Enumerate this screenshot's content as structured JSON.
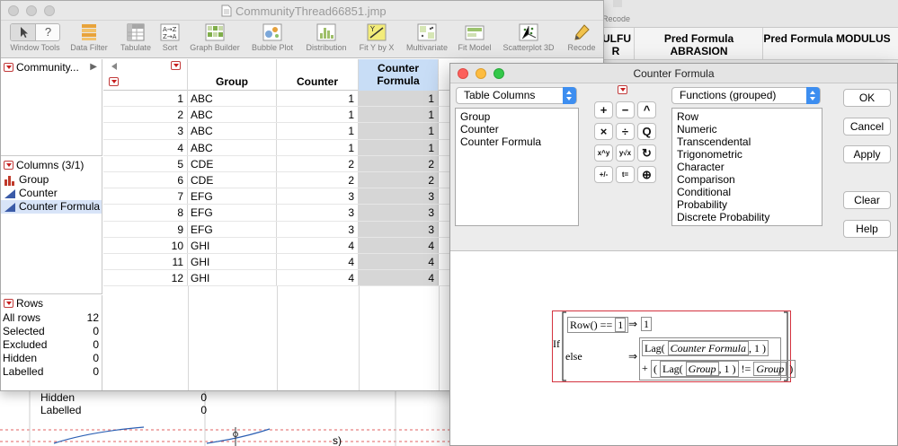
{
  "background_window": {
    "toolbar_partial_label": "Recode",
    "columns": [
      "ULFU R",
      "Pred Formula ABRASION",
      "Pred Formula MODULUS"
    ],
    "bottom_rows": [
      {
        "label": "Hidden",
        "value": "0"
      },
      {
        "label": "Labelled",
        "value": "0"
      }
    ],
    "bottom_text": "s)"
  },
  "data_table": {
    "title": "CommunityThread66851.jmp",
    "toolbar": [
      {
        "label": "Window Tools",
        "icon": "window-tools-icon"
      },
      {
        "label": "Data Filter",
        "icon": "data-filter-icon"
      },
      {
        "label": "Tabulate",
        "icon": "tabulate-icon"
      },
      {
        "label": "Sort",
        "icon": "sort-icon"
      },
      {
        "label": "Graph Builder",
        "icon": "graph-builder-icon"
      },
      {
        "label": "Bubble Plot",
        "icon": "bubble-plot-icon"
      },
      {
        "label": "Distribution",
        "icon": "distribution-icon"
      },
      {
        "label": "Fit Y by X",
        "icon": "fit-y-by-x-icon"
      },
      {
        "label": "Multivariate",
        "icon": "multivariate-icon"
      },
      {
        "label": "Fit Model",
        "icon": "fit-model-icon"
      },
      {
        "label": "Scatterplot 3D",
        "icon": "scatterplot-3d-icon"
      },
      {
        "label": "Recode",
        "icon": "recode-icon"
      }
    ],
    "table_panel": {
      "name": "Community..."
    },
    "columns_panel": {
      "header": "Columns (3/1)",
      "items": [
        {
          "name": "Group",
          "icon": "nominal-bar-icon"
        },
        {
          "name": "Counter",
          "icon": "continuous-triangle-icon"
        },
        {
          "name": "Counter Formula",
          "icon": "continuous-triangle-icon"
        }
      ]
    },
    "rows_panel": {
      "header": "Rows",
      "stats": [
        {
          "label": "All rows",
          "value": "12"
        },
        {
          "label": "Selected",
          "value": "0"
        },
        {
          "label": "Excluded",
          "value": "0"
        },
        {
          "label": "Hidden",
          "value": "0"
        },
        {
          "label": "Labelled",
          "value": "0"
        }
      ]
    },
    "grid": {
      "headers": {
        "group": "Group",
        "counter": "Counter",
        "counter_formula": "Counter Formula"
      },
      "rows": [
        {
          "n": "1",
          "group": "ABC",
          "counter": "1",
          "cf": "1"
        },
        {
          "n": "2",
          "group": "ABC",
          "counter": "1",
          "cf": "1"
        },
        {
          "n": "3",
          "group": "ABC",
          "counter": "1",
          "cf": "1"
        },
        {
          "n": "4",
          "group": "ABC",
          "counter": "1",
          "cf": "1"
        },
        {
          "n": "5",
          "group": "CDE",
          "counter": "2",
          "cf": "2"
        },
        {
          "n": "6",
          "group": "CDE",
          "counter": "2",
          "cf": "2"
        },
        {
          "n": "7",
          "group": "EFG",
          "counter": "3",
          "cf": "3"
        },
        {
          "n": "8",
          "group": "EFG",
          "counter": "3",
          "cf": "3"
        },
        {
          "n": "9",
          "group": "EFG",
          "counter": "3",
          "cf": "3"
        },
        {
          "n": "10",
          "group": "GHI",
          "counter": "4",
          "cf": "4"
        },
        {
          "n": "11",
          "group": "GHI",
          "counter": "4",
          "cf": "4"
        },
        {
          "n": "12",
          "group": "GHI",
          "counter": "4",
          "cf": "4"
        }
      ]
    }
  },
  "formula_dialog": {
    "title": "Counter Formula",
    "table_columns_popup": "Table Columns",
    "table_columns_list": [
      "Group",
      "Counter",
      "Counter Formula"
    ],
    "functions_popup": "Functions (grouped)",
    "functions_list": [
      "Row",
      "Numeric",
      "Transcendental",
      "Trigonometric",
      "Character",
      "Comparison",
      "Conditional",
      "Probability",
      "Discrete Probability"
    ],
    "keypad": [
      "+",
      "−",
      "^",
      "×",
      "÷",
      "Q",
      "x^y",
      "y√x",
      "↻",
      "+/-",
      "t=",
      "⊕"
    ],
    "buttons": {
      "ok": "OK",
      "cancel": "Cancel",
      "apply": "Apply",
      "clear": "Clear",
      "help": "Help"
    },
    "formula": {
      "if": "If",
      "else": "else",
      "row_fn": "Row()",
      "eq": "==",
      "one": "1",
      "arrow": "⇒",
      "lag": "Lag",
      "counter_formula": "Counter Formula",
      "comma_one": ", 1",
      "plus": "+",
      "group": "Group",
      "neq": "!="
    }
  }
}
